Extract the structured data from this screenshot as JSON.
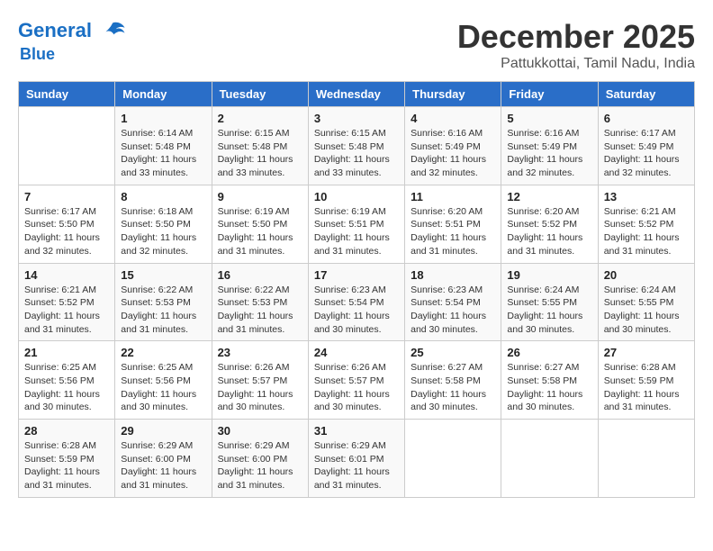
{
  "header": {
    "logo_line1": "General",
    "logo_line2": "Blue",
    "month": "December 2025",
    "location": "Pattukkottai, Tamil Nadu, India"
  },
  "weekdays": [
    "Sunday",
    "Monday",
    "Tuesday",
    "Wednesday",
    "Thursday",
    "Friday",
    "Saturday"
  ],
  "weeks": [
    [
      {
        "day": "",
        "sunrise": "",
        "sunset": "",
        "daylight": ""
      },
      {
        "day": "1",
        "sunrise": "Sunrise: 6:14 AM",
        "sunset": "Sunset: 5:48 PM",
        "daylight": "Daylight: 11 hours and 33 minutes."
      },
      {
        "day": "2",
        "sunrise": "Sunrise: 6:15 AM",
        "sunset": "Sunset: 5:48 PM",
        "daylight": "Daylight: 11 hours and 33 minutes."
      },
      {
        "day": "3",
        "sunrise": "Sunrise: 6:15 AM",
        "sunset": "Sunset: 5:48 PM",
        "daylight": "Daylight: 11 hours and 33 minutes."
      },
      {
        "day": "4",
        "sunrise": "Sunrise: 6:16 AM",
        "sunset": "Sunset: 5:49 PM",
        "daylight": "Daylight: 11 hours and 32 minutes."
      },
      {
        "day": "5",
        "sunrise": "Sunrise: 6:16 AM",
        "sunset": "Sunset: 5:49 PM",
        "daylight": "Daylight: 11 hours and 32 minutes."
      },
      {
        "day": "6",
        "sunrise": "Sunrise: 6:17 AM",
        "sunset": "Sunset: 5:49 PM",
        "daylight": "Daylight: 11 hours and 32 minutes."
      }
    ],
    [
      {
        "day": "7",
        "sunrise": "Sunrise: 6:17 AM",
        "sunset": "Sunset: 5:50 PM",
        "daylight": "Daylight: 11 hours and 32 minutes."
      },
      {
        "day": "8",
        "sunrise": "Sunrise: 6:18 AM",
        "sunset": "Sunset: 5:50 PM",
        "daylight": "Daylight: 11 hours and 32 minutes."
      },
      {
        "day": "9",
        "sunrise": "Sunrise: 6:19 AM",
        "sunset": "Sunset: 5:50 PM",
        "daylight": "Daylight: 11 hours and 31 minutes."
      },
      {
        "day": "10",
        "sunrise": "Sunrise: 6:19 AM",
        "sunset": "Sunset: 5:51 PM",
        "daylight": "Daylight: 11 hours and 31 minutes."
      },
      {
        "day": "11",
        "sunrise": "Sunrise: 6:20 AM",
        "sunset": "Sunset: 5:51 PM",
        "daylight": "Daylight: 11 hours and 31 minutes."
      },
      {
        "day": "12",
        "sunrise": "Sunrise: 6:20 AM",
        "sunset": "Sunset: 5:52 PM",
        "daylight": "Daylight: 11 hours and 31 minutes."
      },
      {
        "day": "13",
        "sunrise": "Sunrise: 6:21 AM",
        "sunset": "Sunset: 5:52 PM",
        "daylight": "Daylight: 11 hours and 31 minutes."
      }
    ],
    [
      {
        "day": "14",
        "sunrise": "Sunrise: 6:21 AM",
        "sunset": "Sunset: 5:52 PM",
        "daylight": "Daylight: 11 hours and 31 minutes."
      },
      {
        "day": "15",
        "sunrise": "Sunrise: 6:22 AM",
        "sunset": "Sunset: 5:53 PM",
        "daylight": "Daylight: 11 hours and 31 minutes."
      },
      {
        "day": "16",
        "sunrise": "Sunrise: 6:22 AM",
        "sunset": "Sunset: 5:53 PM",
        "daylight": "Daylight: 11 hours and 31 minutes."
      },
      {
        "day": "17",
        "sunrise": "Sunrise: 6:23 AM",
        "sunset": "Sunset: 5:54 PM",
        "daylight": "Daylight: 11 hours and 30 minutes."
      },
      {
        "day": "18",
        "sunrise": "Sunrise: 6:23 AM",
        "sunset": "Sunset: 5:54 PM",
        "daylight": "Daylight: 11 hours and 30 minutes."
      },
      {
        "day": "19",
        "sunrise": "Sunrise: 6:24 AM",
        "sunset": "Sunset: 5:55 PM",
        "daylight": "Daylight: 11 hours and 30 minutes."
      },
      {
        "day": "20",
        "sunrise": "Sunrise: 6:24 AM",
        "sunset": "Sunset: 5:55 PM",
        "daylight": "Daylight: 11 hours and 30 minutes."
      }
    ],
    [
      {
        "day": "21",
        "sunrise": "Sunrise: 6:25 AM",
        "sunset": "Sunset: 5:56 PM",
        "daylight": "Daylight: 11 hours and 30 minutes."
      },
      {
        "day": "22",
        "sunrise": "Sunrise: 6:25 AM",
        "sunset": "Sunset: 5:56 PM",
        "daylight": "Daylight: 11 hours and 30 minutes."
      },
      {
        "day": "23",
        "sunrise": "Sunrise: 6:26 AM",
        "sunset": "Sunset: 5:57 PM",
        "daylight": "Daylight: 11 hours and 30 minutes."
      },
      {
        "day": "24",
        "sunrise": "Sunrise: 6:26 AM",
        "sunset": "Sunset: 5:57 PM",
        "daylight": "Daylight: 11 hours and 30 minutes."
      },
      {
        "day": "25",
        "sunrise": "Sunrise: 6:27 AM",
        "sunset": "Sunset: 5:58 PM",
        "daylight": "Daylight: 11 hours and 30 minutes."
      },
      {
        "day": "26",
        "sunrise": "Sunrise: 6:27 AM",
        "sunset": "Sunset: 5:58 PM",
        "daylight": "Daylight: 11 hours and 30 minutes."
      },
      {
        "day": "27",
        "sunrise": "Sunrise: 6:28 AM",
        "sunset": "Sunset: 5:59 PM",
        "daylight": "Daylight: 11 hours and 31 minutes."
      }
    ],
    [
      {
        "day": "28",
        "sunrise": "Sunrise: 6:28 AM",
        "sunset": "Sunset: 5:59 PM",
        "daylight": "Daylight: 11 hours and 31 minutes."
      },
      {
        "day": "29",
        "sunrise": "Sunrise: 6:29 AM",
        "sunset": "Sunset: 6:00 PM",
        "daylight": "Daylight: 11 hours and 31 minutes."
      },
      {
        "day": "30",
        "sunrise": "Sunrise: 6:29 AM",
        "sunset": "Sunset: 6:00 PM",
        "daylight": "Daylight: 11 hours and 31 minutes."
      },
      {
        "day": "31",
        "sunrise": "Sunrise: 6:29 AM",
        "sunset": "Sunset: 6:01 PM",
        "daylight": "Daylight: 11 hours and 31 minutes."
      },
      {
        "day": "",
        "sunrise": "",
        "sunset": "",
        "daylight": ""
      },
      {
        "day": "",
        "sunrise": "",
        "sunset": "",
        "daylight": ""
      },
      {
        "day": "",
        "sunrise": "",
        "sunset": "",
        "daylight": ""
      }
    ]
  ]
}
